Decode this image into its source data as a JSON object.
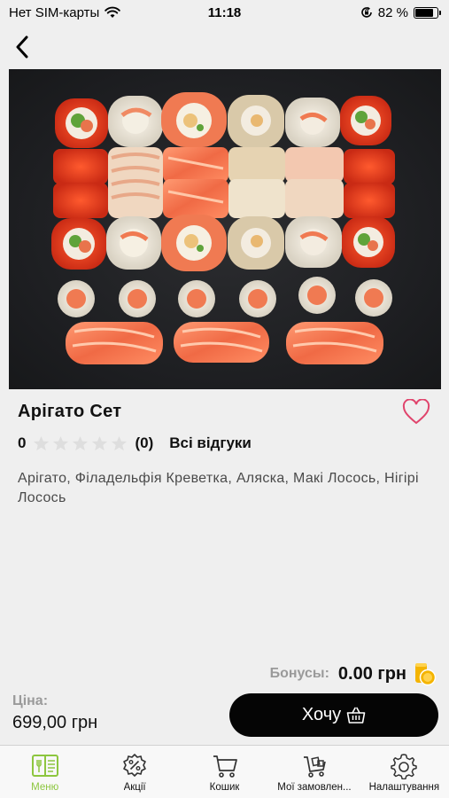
{
  "status_bar": {
    "carrier": "Нет SIM-карты",
    "time": "11:18",
    "battery": "82 %",
    "battery_level": 0.82
  },
  "product": {
    "title": "Арігато Сет",
    "rating_value": "0",
    "stars_filled": 0,
    "stars_total": 5,
    "reviews_count": "(0)",
    "all_reviews_label": "Всі відгуки",
    "description": "Арігато, Філадельфія Креветка, Аляска, Макі Лосось, Нігірі Лосось"
  },
  "bonus": {
    "label": "Бонусы:",
    "value": "0.00 грн"
  },
  "price": {
    "label": "Ціна:",
    "value": "699,00 грн"
  },
  "actions": {
    "want_label": "Хочу"
  },
  "tabbar": {
    "tabs": [
      {
        "label": "Меню",
        "icon": "menu-book-icon",
        "active": true
      },
      {
        "label": "Акції",
        "icon": "discount-badge-icon",
        "active": false
      },
      {
        "label": "Кошик",
        "icon": "cart-icon",
        "active": false
      },
      {
        "label": "Мої замовлен...",
        "icon": "orders-cart-icon",
        "active": false
      },
      {
        "label": "Налаштування",
        "icon": "gear-icon",
        "active": false
      }
    ]
  },
  "colors": {
    "accent": "#8dc63f",
    "button_bg": "#050505",
    "heart": "#e0446c",
    "coin": "#f4b400"
  }
}
